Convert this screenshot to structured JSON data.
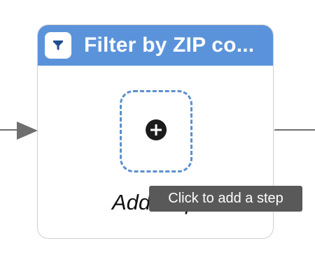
{
  "step": {
    "title": "Filter by ZIP co...",
    "header_icon": "filter-funnel-icon",
    "add_step": {
      "icon": "plus-circle-icon",
      "label": "Add step",
      "label_visible": "Add",
      "label_hidden": " step"
    }
  },
  "tooltip": {
    "text": "Click to add a step"
  },
  "colors": {
    "header": "#5b93db",
    "dashed_border": "#5b8fce",
    "connector": "#6f6f6f",
    "tooltip_bg": "#595959",
    "card_border": "#cfcfcf"
  }
}
